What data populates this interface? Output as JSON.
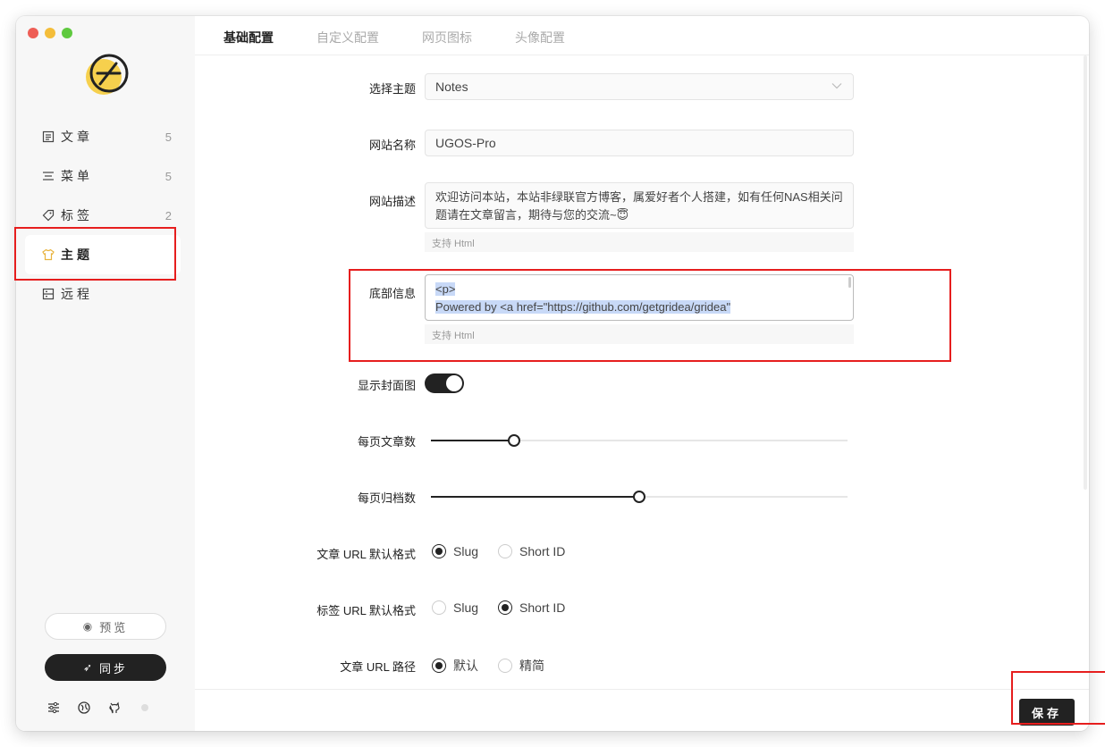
{
  "sidebar": {
    "items": [
      {
        "label": "文章",
        "count": "5",
        "icon": "article-icon"
      },
      {
        "label": "菜单",
        "count": "5",
        "icon": "menu-icon"
      },
      {
        "label": "标签",
        "count": "2",
        "icon": "tag-icon"
      },
      {
        "label": "主题",
        "count": "",
        "icon": "shirt-icon"
      },
      {
        "label": "远程",
        "count": "",
        "icon": "remote-icon"
      }
    ],
    "active_item": "主题",
    "preview_label": "预览",
    "sync_label": "同步"
  },
  "tabs": [
    "基础配置",
    "自定义配置",
    "网页图标",
    "头像配置"
  ],
  "active_tab": "基础配置",
  "form": {
    "theme_label": "选择主题",
    "theme_value": "Notes",
    "site_name_label": "网站名称",
    "site_name_value": "UGOS-Pro",
    "site_desc_label": "网站描述",
    "site_desc_value": "欢迎访问本站，本站非绿联官方博客，属爱好者个人搭建，如有任何NAS相关问题请在文章留言，期待与您的交流~😇",
    "site_desc_hint": "支持 Html",
    "footer_label": "底部信息",
    "footer_line1": "<p>",
    "footer_line2": "Powered by <a href=\"https://github.com/getgridea/gridea\"",
    "footer_hint": "支持 Html",
    "show_cover_label": "显示封面图",
    "show_cover_on": true,
    "posts_per_page_label": "每页文章数",
    "posts_per_page_level": 0.2,
    "archives_per_page_label": "每页归档数",
    "archives_per_page_level": 0.5,
    "post_url_label": "文章 URL 默认格式",
    "post_url_options": [
      "Slug",
      "Short ID"
    ],
    "post_url_selected": "Slug",
    "tag_url_label": "标签 URL 默认格式",
    "tag_url_options": [
      "Slug",
      "Short ID"
    ],
    "tag_url_selected": "Short ID",
    "post_path_label": "文章 URL 路径",
    "post_path_options": [
      "默认",
      "精简"
    ],
    "post_path_selected": "默认"
  },
  "save_label": "保存",
  "colors": {
    "accent": "#222222",
    "highlight": "#e61e1e",
    "logo_yellow": "#f6d04d"
  }
}
